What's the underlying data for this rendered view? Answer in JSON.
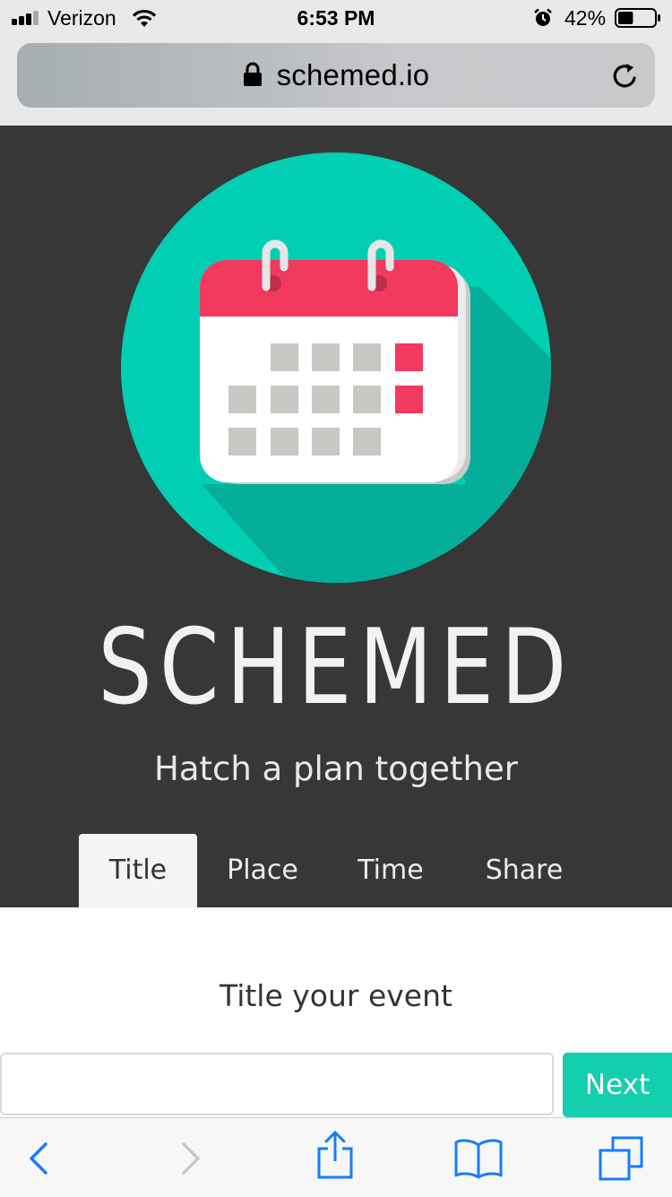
{
  "status_bar": {
    "carrier": "Verizon",
    "time": "6:53 PM",
    "battery": "42%",
    "battery_level": 0.42,
    "signal_bars_filled": 3,
    "signal_bars_total": 4,
    "icons": [
      "signal-icon",
      "wifi-icon",
      "alarm-icon",
      "battery-icon"
    ]
  },
  "address_bar": {
    "url": "schemed.io",
    "icons": [
      "lock-icon",
      "reload-icon"
    ]
  },
  "hero": {
    "brand": "SCHEMED",
    "tagline": "Hatch a plan together",
    "logo_icon": "calendar-logo-icon"
  },
  "tabs": [
    {
      "label": "Title",
      "active": true
    },
    {
      "label": "Place",
      "active": false
    },
    {
      "label": "Time",
      "active": false
    },
    {
      "label": "Share",
      "active": false
    }
  ],
  "form": {
    "heading": "Title your event",
    "input_value": "",
    "input_placeholder": "",
    "next_label": "Next"
  },
  "toolbar": {
    "icons": [
      "back-icon",
      "forward-icon",
      "share-icon",
      "bookmarks-icon",
      "tabs-icon"
    ],
    "forward_enabled": false
  },
  "colors": {
    "accent": "#13cfae",
    "logo_circle": "#00cfb4",
    "calendar_header": "#f2395e",
    "hero_background": "#373737",
    "ios_blue": "#157efb"
  }
}
